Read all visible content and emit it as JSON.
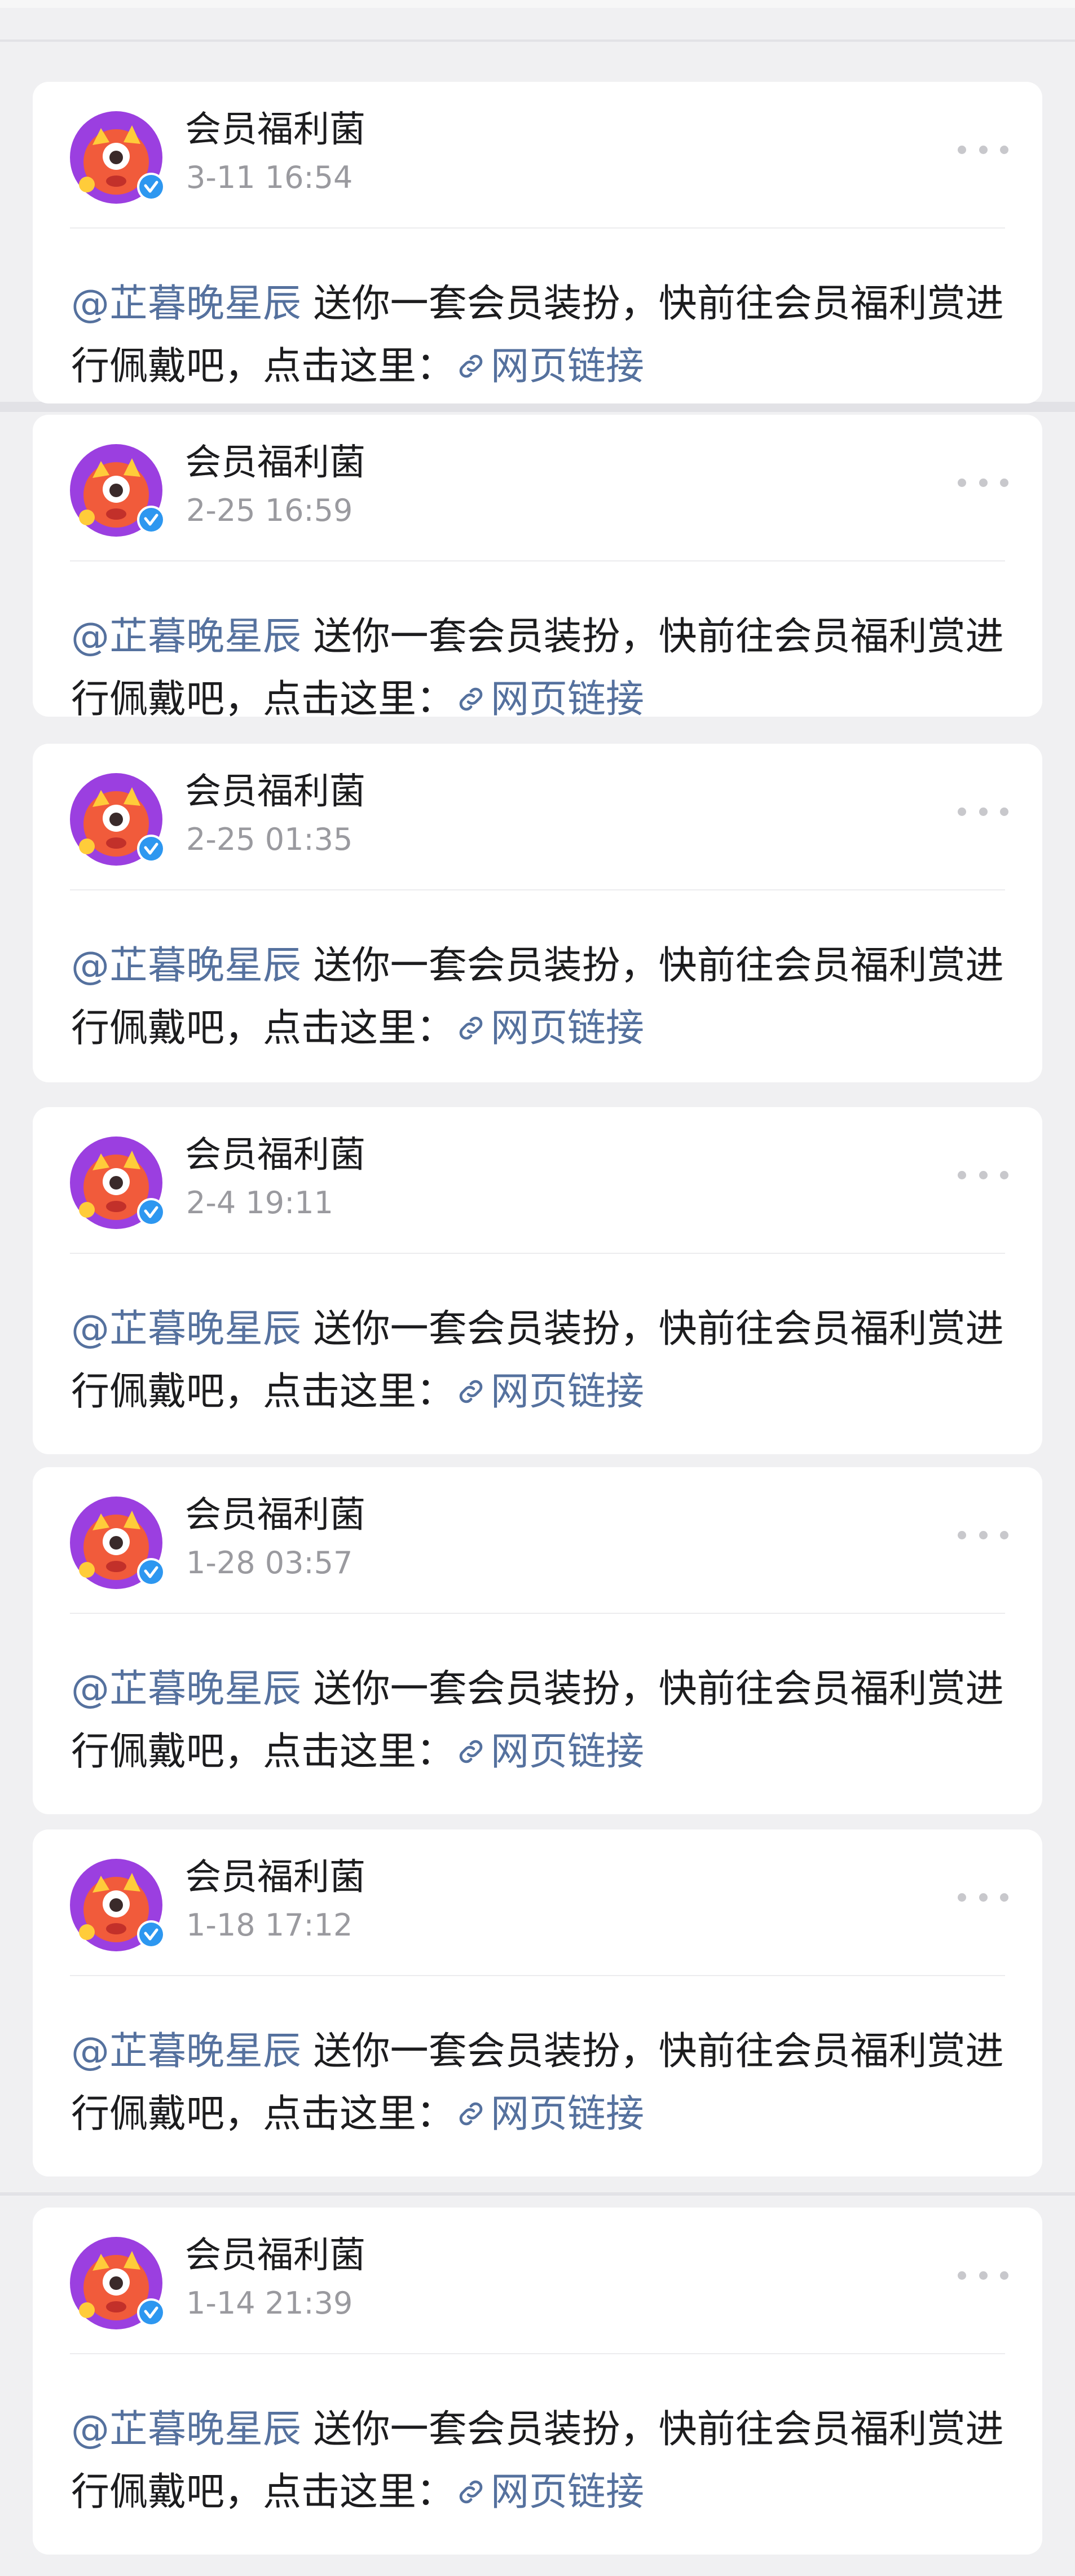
{
  "posts": [
    {
      "author": "会员福利菌",
      "time": "3-11 16:54",
      "mention": "@芷暮晚星辰",
      "text": " 送你一套会员装扮，快前往会员福利赏进行佩戴吧，点击这里：",
      "link": "网页链接"
    },
    {
      "author": "会员福利菌",
      "time": "2-25 16:59",
      "mention": "@芷暮晚星辰",
      "text": " 送你一套会员装扮，快前往会员福利赏进行佩戴吧，点击这里：",
      "link": "网页链接"
    },
    {
      "author": "会员福利菌",
      "time": "2-25 01:35",
      "mention": "@芷暮晚星辰",
      "text": " 送你一套会员装扮，快前往会员福利赏进行佩戴吧，点击这里：",
      "link": "网页链接"
    },
    {
      "author": "会员福利菌",
      "time": "2-4 19:11",
      "mention": "@芷暮晚星辰",
      "text": " 送你一套会员装扮，快前往会员福利赏进行佩戴吧，点击这里：",
      "link": "网页链接"
    },
    {
      "author": "会员福利菌",
      "time": "1-28 03:57",
      "mention": "@芷暮晚星辰",
      "text": " 送你一套会员装扮，快前往会员福利赏进行佩戴吧，点击这里：",
      "link": "网页链接"
    },
    {
      "author": "会员福利菌",
      "time": "1-18 17:12",
      "mention": "@芷暮晚星辰",
      "text": " 送你一套会员装扮，快前往会员福利赏进行佩戴吧，点击这里：",
      "link": "网页链接"
    },
    {
      "author": "会员福利菌",
      "time": "1-14 21:39",
      "mention": "@芷暮晚星辰",
      "text": " 送你一套会员装扮，快前往会员福利赏进行佩戴吧，点击这里：",
      "link": "网页链接"
    }
  ],
  "colors": {
    "mention": "#55719e",
    "verified": "#2d97f0",
    "avatar_bg": "#9b3fe0",
    "mascot": "#f15b3b"
  },
  "icons": {
    "avatar": "mascot-avatar-icon",
    "verified": "verified-badge-icon",
    "more": "more-dots-icon",
    "link": "link-icon"
  }
}
